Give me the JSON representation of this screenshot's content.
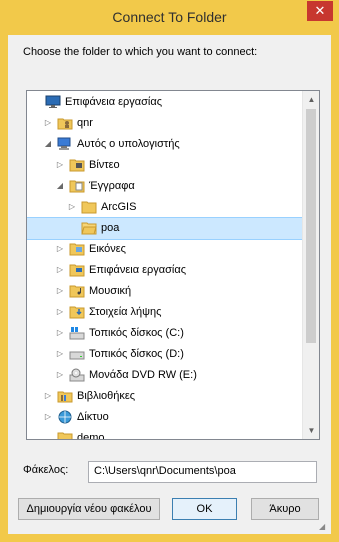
{
  "window": {
    "title": "Connect To Folder",
    "close_label": "✕"
  },
  "prompt": "Choose the folder to which you want to connect:",
  "tree": [
    {
      "label": "Επιφάνεια εργασίας",
      "icon": "desktop-icon",
      "indent": 0,
      "arrow": "",
      "selected": false
    },
    {
      "label": "qnr",
      "icon": "user-icon",
      "indent": 1,
      "arrow": "▷",
      "selected": false
    },
    {
      "label": "Αυτός ο υπολογιστής",
      "icon": "computer-icon",
      "indent": 1,
      "arrow": "◢",
      "selected": false
    },
    {
      "label": "Βίντεο",
      "icon": "video-folder-icon",
      "indent": 2,
      "arrow": "▷",
      "selected": false
    },
    {
      "label": "Έγγραφα",
      "icon": "documents-folder-icon",
      "indent": 2,
      "arrow": "◢",
      "selected": false
    },
    {
      "label": "ArcGIS",
      "icon": "folder-icon",
      "indent": 3,
      "arrow": "▷",
      "selected": false
    },
    {
      "label": "poa",
      "icon": "folder-open-icon",
      "indent": 3,
      "arrow": "",
      "selected": true
    },
    {
      "label": "Εικόνες",
      "icon": "pictures-folder-icon",
      "indent": 2,
      "arrow": "▷",
      "selected": false
    },
    {
      "label": "Επιφάνεια εργασίας",
      "icon": "desktop-folder-icon",
      "indent": 2,
      "arrow": "▷",
      "selected": false
    },
    {
      "label": "Μουσική",
      "icon": "music-folder-icon",
      "indent": 2,
      "arrow": "▷",
      "selected": false
    },
    {
      "label": "Στοιχεία λήψης",
      "icon": "downloads-folder-icon",
      "indent": 2,
      "arrow": "▷",
      "selected": false
    },
    {
      "label": "Τοπικός δίσκος (C:)",
      "icon": "windows-drive-icon",
      "indent": 2,
      "arrow": "▷",
      "selected": false
    },
    {
      "label": "Τοπικός δίσκος (D:)",
      "icon": "drive-icon",
      "indent": 2,
      "arrow": "▷",
      "selected": false
    },
    {
      "label": "Μονάδα DVD RW (E:)",
      "icon": "dvd-drive-icon",
      "indent": 2,
      "arrow": "▷",
      "selected": false
    },
    {
      "label": "Βιβλιοθήκες",
      "icon": "libraries-icon",
      "indent": 1,
      "arrow": "▷",
      "selected": false
    },
    {
      "label": "Δίκτυο",
      "icon": "network-icon",
      "indent": 1,
      "arrow": "▷",
      "selected": false
    },
    {
      "label": "demo",
      "icon": "folder-icon",
      "indent": 1,
      "arrow": "",
      "selected": false
    }
  ],
  "folder_field": {
    "label": "Φάκελος:",
    "value": "C:\\Users\\qnr\\Documents\\poa"
  },
  "buttons": {
    "new_folder": "Δημιουργία νέου φακέλου",
    "ok": "OK",
    "cancel": "Άκυρο"
  },
  "colors": {
    "accent": "#f2c94a",
    "selection": "#cce8ff",
    "close": "#c7372f"
  }
}
